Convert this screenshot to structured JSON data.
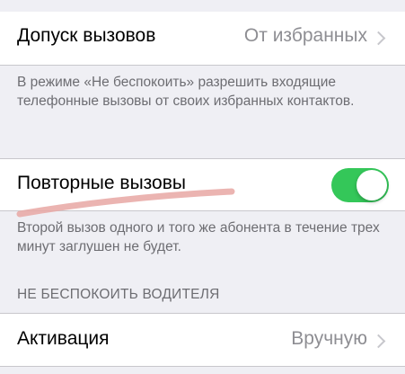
{
  "allow_calls": {
    "label": "Допуск вызовов",
    "value": "От избранных"
  },
  "allow_calls_footer": "В режиме «Не беспокоить» разрешить входящие телефонные вызовы от своих избранных контактов.",
  "repeated_calls": {
    "label": "Повторные вызовы",
    "toggle_on": true,
    "toggle_color": "#34c759"
  },
  "repeated_calls_footer": "Второй вызов одного и того же абонента в течение трех минут заглушен не будет.",
  "driving_section": {
    "header": "НЕ БЕСПОКОИТЬ ВОДИТЕЛЯ"
  },
  "activation": {
    "label": "Активация",
    "value": "Вручную"
  },
  "icons": {
    "chevron": "chevron-right-icon"
  },
  "annotation_color": "#e8a7a3"
}
